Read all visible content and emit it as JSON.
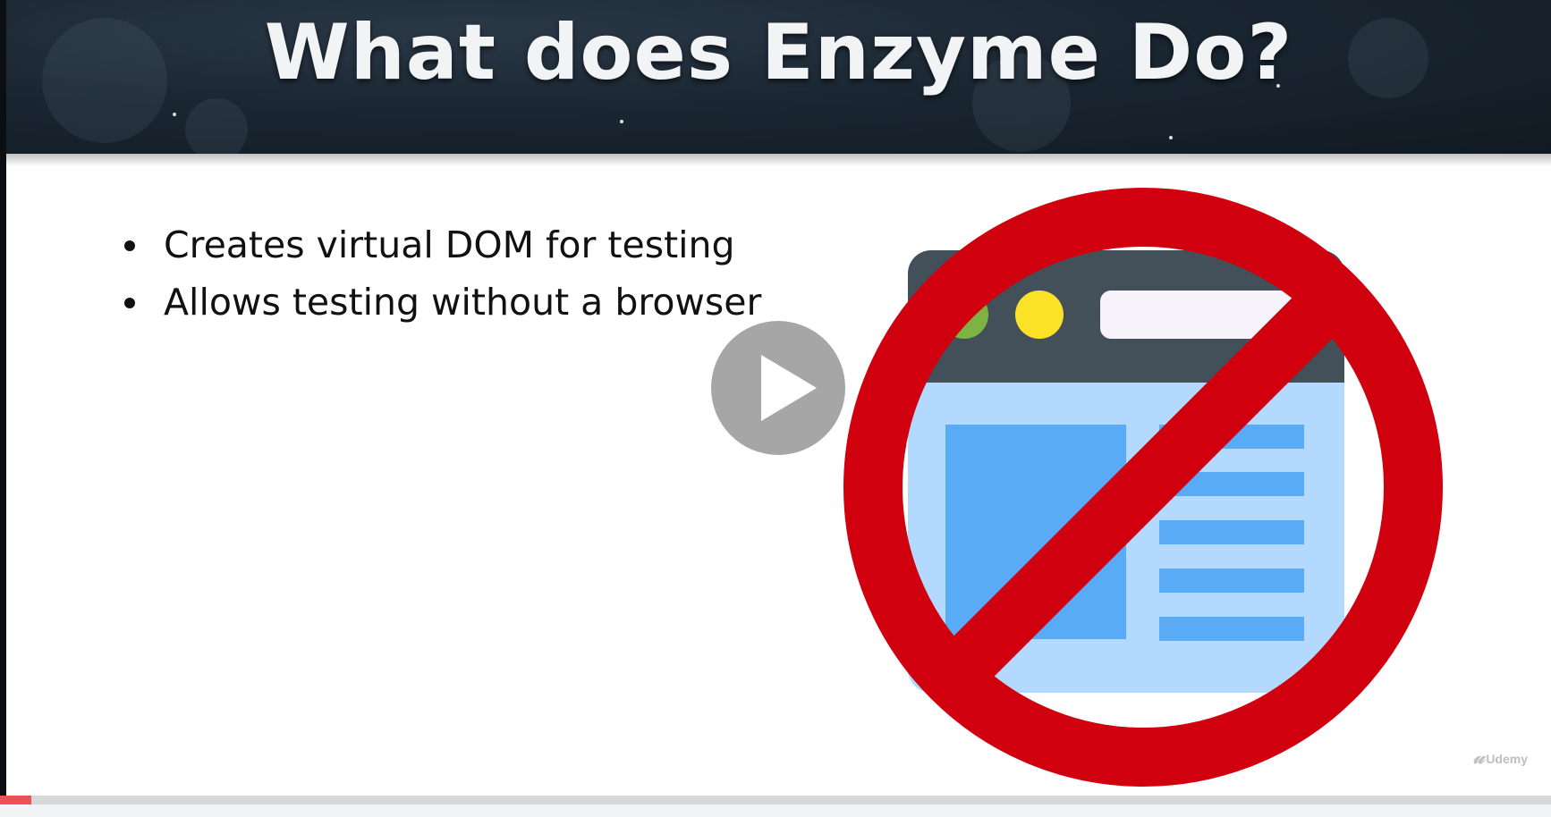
{
  "slide": {
    "title": "What does Enzyme Do?",
    "bullets": [
      "Creates virtual DOM for testing",
      "Allows testing without a browser"
    ]
  },
  "illustration": {
    "icon": "no-browser-icon",
    "colors": {
      "prohibition_red": "#d0000f",
      "browser_frame": "#434f59",
      "browser_body": "#b3d9ff",
      "browser_blocks": "#5aabf5",
      "dot_green": "#7cb342",
      "dot_yellow": "#fbe128",
      "address_bar": "#f6f4fa"
    }
  },
  "player": {
    "play_icon": "play-icon",
    "watermark": "Udemy",
    "progress_fraction": 0.02,
    "progress_color": "#ec5252"
  },
  "colors": {
    "header_bg": "#1a2632",
    "title_text": "#f1f3f4",
    "bullet_text": "#111111"
  }
}
